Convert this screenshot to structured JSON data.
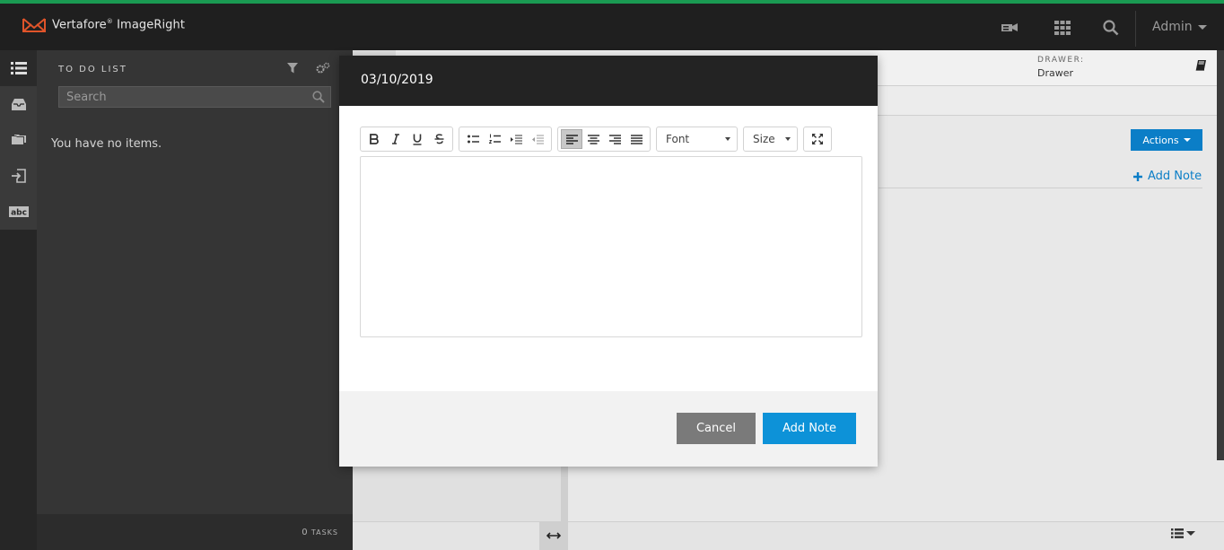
{
  "app": {
    "brand": "Vertafore",
    "brand_mark": "®",
    "product": "ImageRight",
    "user_menu_label": "Admin",
    "accent_color": "#0d92d8",
    "top_border_color": "#1a9a52"
  },
  "header_icons": [
    "workflow-icon",
    "apps-grid-icon",
    "search-icon"
  ],
  "rail": {
    "items": [
      "list-icon",
      "inbox-icon",
      "folders-icon",
      "import-icon",
      "abc-icon"
    ]
  },
  "todo": {
    "title": "TO DO LIST",
    "search_placeholder": "Search",
    "empty_message": "You have no items.",
    "task_count": "0",
    "task_label": "TASKS"
  },
  "main": {
    "drawer_label": "DRAWER:",
    "drawer_value": "Drawer",
    "actions_label": "Actions",
    "add_note_label": "Add Note"
  },
  "modal": {
    "title": "03/10/2019",
    "toolbar": {
      "font_label": "Font",
      "size_label": "Size",
      "active_align": "left"
    },
    "cancel_label": "Cancel",
    "submit_label": "Add Note"
  }
}
